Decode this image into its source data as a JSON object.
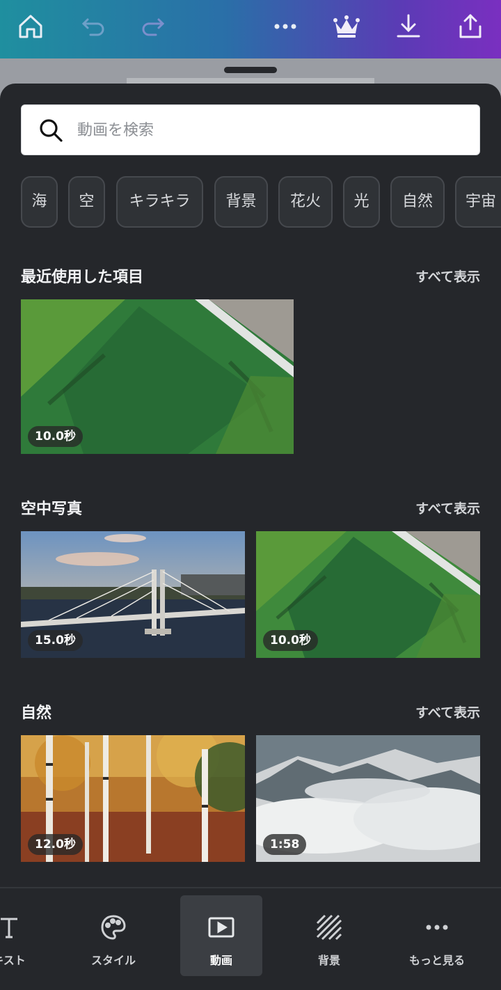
{
  "colors": {
    "accent_start": "#1f8f9f",
    "accent_end": "#7a2fc0",
    "sheet_bg": "#25272b",
    "chip_bg": "#2f3236"
  },
  "topbar": {
    "icons": [
      "home-icon",
      "undo-icon",
      "redo-icon",
      "more-icon",
      "crown-icon",
      "download-icon",
      "share-icon"
    ]
  },
  "search": {
    "placeholder": "動画を検索",
    "value": ""
  },
  "chips": [
    "海",
    "空",
    "キラキラ",
    "背景",
    "花火",
    "光",
    "自然",
    "宇宙"
  ],
  "sections": [
    {
      "title": "最近使用した項目",
      "link": "すべて表示",
      "items": [
        {
          "duration": "10.0秒",
          "image": "aerial-field-thumbnail"
        }
      ]
    },
    {
      "title": "空中写真",
      "link": "すべて表示",
      "items": [
        {
          "duration": "15.0秒",
          "image": "cable-bridge-thumbnail"
        },
        {
          "duration": "10.0秒",
          "image": "aerial-field-thumbnail"
        }
      ]
    },
    {
      "title": "自然",
      "link": "すべて表示",
      "items": [
        {
          "duration": "12.0秒",
          "image": "birch-forest-thumbnail"
        },
        {
          "duration": "1:58",
          "image": "misty-forest-thumbnail"
        }
      ]
    }
  ],
  "bottom_nav": [
    {
      "label": "キスト",
      "icon": "text-icon"
    },
    {
      "label": "スタイル",
      "icon": "palette-icon"
    },
    {
      "label": "動画",
      "icon": "video-icon",
      "active": true
    },
    {
      "label": "背景",
      "icon": "background-icon"
    },
    {
      "label": "もっと見る",
      "icon": "more-icon"
    }
  ]
}
